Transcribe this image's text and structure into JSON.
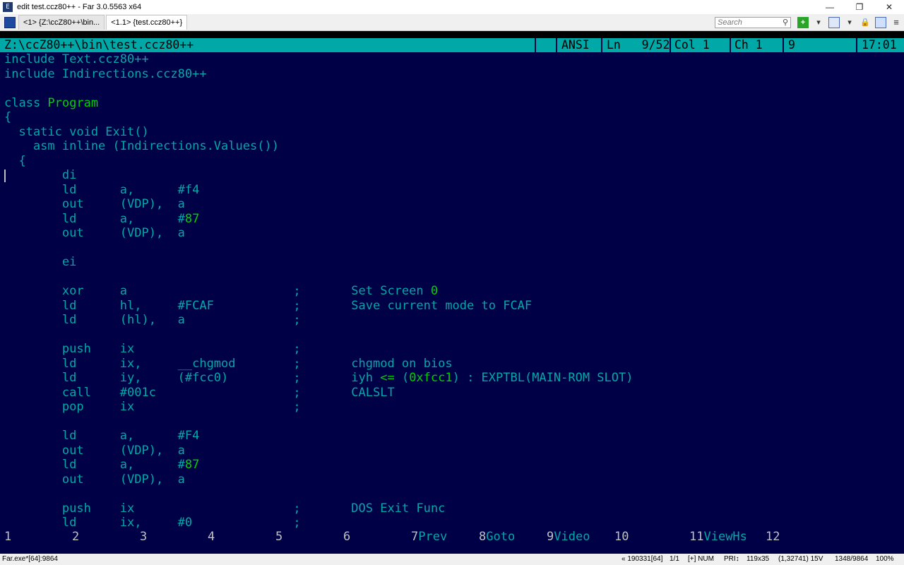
{
  "window": {
    "title": "edit test.ccz80++ - Far 3.0.5563 x64",
    "app_icon": "E",
    "minimize": "—",
    "restore": "❐",
    "close": "✕"
  },
  "tabs": [
    {
      "label": "<1>  {Z:\\ccZ80++\\bin..."
    },
    {
      "label": "<1.1> {test.ccz80++}"
    }
  ],
  "search": {
    "placeholder": "Search",
    "icon": "⚲"
  },
  "toolbar": {
    "plus": "+",
    "arrow1": "▾",
    "arrow2": "▾",
    "menu": "≡"
  },
  "editor_status": {
    "path": "Z:\\ccZ80++\\bin\\test.ccz80++",
    "encoding": "ANSI",
    "line": "Ln   9/52",
    "col": "Col 1",
    "ch": "Ch 1",
    "code": "9",
    "clock": "17:01"
  },
  "code_lines": [
    "include Text.ccz80++",
    "include Indirections.ccz80++",
    "",
    "class |Program|",
    "{",
    "  static void Exit()",
    "    asm inline (Indirections.Values())",
    "  {",
    "        di",
    "        ld      a,      #f4",
    "        out     (VDP),  a",
    "        ld      a,      #|87|",
    "        out     (VDP),  a",
    "",
    "        ei",
    "",
    "        xor     a                       ;       Set Screen |0|",
    "        ld      hl,     #FCAF           ;       Save current mode to FCAF",
    "        ld      (hl),   a               ;",
    "",
    "        push    ix                      ;",
    "        ld      ix,     __chgmod        ;       chgmod on bios",
    "        ld      iy,     (#fcc0)         ;       iyh |<=| (|0xfcc1|) : EXPTBL(MAIN-ROM SLOT)",
    "        call    #001c                   ;       CALSLT",
    "        pop     ix                      ;",
    "",
    "        ld      a,      #F4",
    "        out     (VDP),  a",
    "        ld      a,      #|87|",
    "        out     (VDP),  a",
    "",
    "        push    ix                      ;       DOS Exit Func",
    "        ld      ix,     #0              ;"
  ],
  "keybar": [
    {
      "num": "1",
      "label": ""
    },
    {
      "num": "2",
      "label": ""
    },
    {
      "num": "3",
      "label": ""
    },
    {
      "num": "4",
      "label": ""
    },
    {
      "num": "5",
      "label": ""
    },
    {
      "num": "6",
      "label": ""
    },
    {
      "num": "7",
      "label": "Prev"
    },
    {
      "num": "8",
      "label": "Goto"
    },
    {
      "num": "9",
      "label": "Video"
    },
    {
      "num": "10",
      "label": ""
    },
    {
      "num": "11",
      "label": "ViewHs"
    },
    {
      "num": "12",
      "label": ""
    }
  ],
  "bottom": {
    "process": "Far.exe*[64]:9864",
    "pos": "« 190331[64]",
    "pages": "1/1",
    "num": "[+] NUM",
    "pri": "PRI↕",
    "size": "119x35",
    "coords": "(1,32741) 15V",
    "pid": "1348/9864",
    "zoom": "100%"
  },
  "colors": {
    "console_bg": "#000046",
    "text": "#00a8a8",
    "highlight": "#00d000",
    "status_bg": "#00a8a8"
  }
}
